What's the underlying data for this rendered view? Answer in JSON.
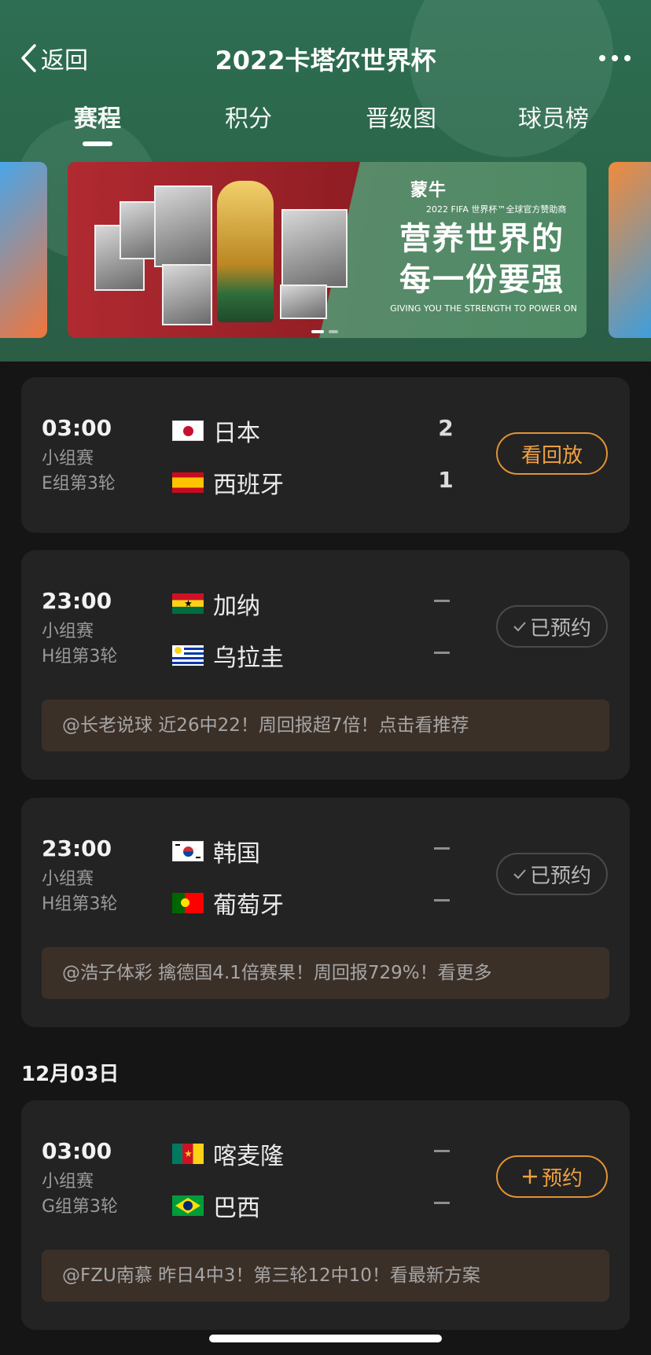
{
  "header": {
    "back_label": "返回",
    "title": "2022卡塔尔世界杯"
  },
  "tabs": [
    {
      "label": "赛程",
      "active": true
    },
    {
      "label": "积分",
      "active": false
    },
    {
      "label": "晋级图",
      "active": false
    },
    {
      "label": "球员榜",
      "active": false
    }
  ],
  "banner": {
    "brand": "蒙牛",
    "brand_sub": "2022 FIFA 世界杯™全球官方赞助商",
    "slogan_line1": "营养世界的",
    "slogan_line2": "每一份要强",
    "slogan_en": "GIVING YOU THE STRENGTH TO POWER ON",
    "carousel_pages": 2,
    "carousel_current": 1
  },
  "matches": [
    {
      "time": "03:00",
      "stage": "小组赛",
      "round": "E组第3轮",
      "home": {
        "name": "日本",
        "flag": "japan",
        "score": "2"
      },
      "away": {
        "name": "西班牙",
        "flag": "spain",
        "score": "1"
      },
      "button": {
        "label": "看回放",
        "style": "orange",
        "icon": ""
      },
      "tip": ""
    },
    {
      "time": "23:00",
      "stage": "小组赛",
      "round": "H组第3轮",
      "home": {
        "name": "加纳",
        "flag": "ghana",
        "score": ""
      },
      "away": {
        "name": "乌拉圭",
        "flag": "uruguay",
        "score": ""
      },
      "button": {
        "label": "已预约",
        "style": "grey",
        "icon": "check-icon"
      },
      "tip": "@长老说球 近26中22！周回报超7倍！点击看推荐"
    },
    {
      "time": "23:00",
      "stage": "小组赛",
      "round": "H组第3轮",
      "home": {
        "name": "韩国",
        "flag": "korea",
        "score": ""
      },
      "away": {
        "name": "葡萄牙",
        "flag": "portugal",
        "score": ""
      },
      "button": {
        "label": "已预约",
        "style": "grey",
        "icon": "check-icon"
      },
      "tip": "@浩子体彩 擒德国4.1倍赛果！周回报729%！看更多"
    },
    {
      "date_header": "12月03日",
      "time": "03:00",
      "stage": "小组赛",
      "round": "G组第3轮",
      "home": {
        "name": "喀麦隆",
        "flag": "cameroon",
        "score": ""
      },
      "away": {
        "name": "巴西",
        "flag": "brazil",
        "score": ""
      },
      "button": {
        "label": "预约",
        "style": "orange",
        "icon": "plus-icon"
      },
      "tip": "@FZU南慕 昨日4中3！第三轮12中10！看最新方案"
    }
  ],
  "colors": {
    "accent": "#e39233",
    "hero_green": "#2e6e52",
    "card_bg": "#232323",
    "tip_bg": "#3b3028"
  }
}
